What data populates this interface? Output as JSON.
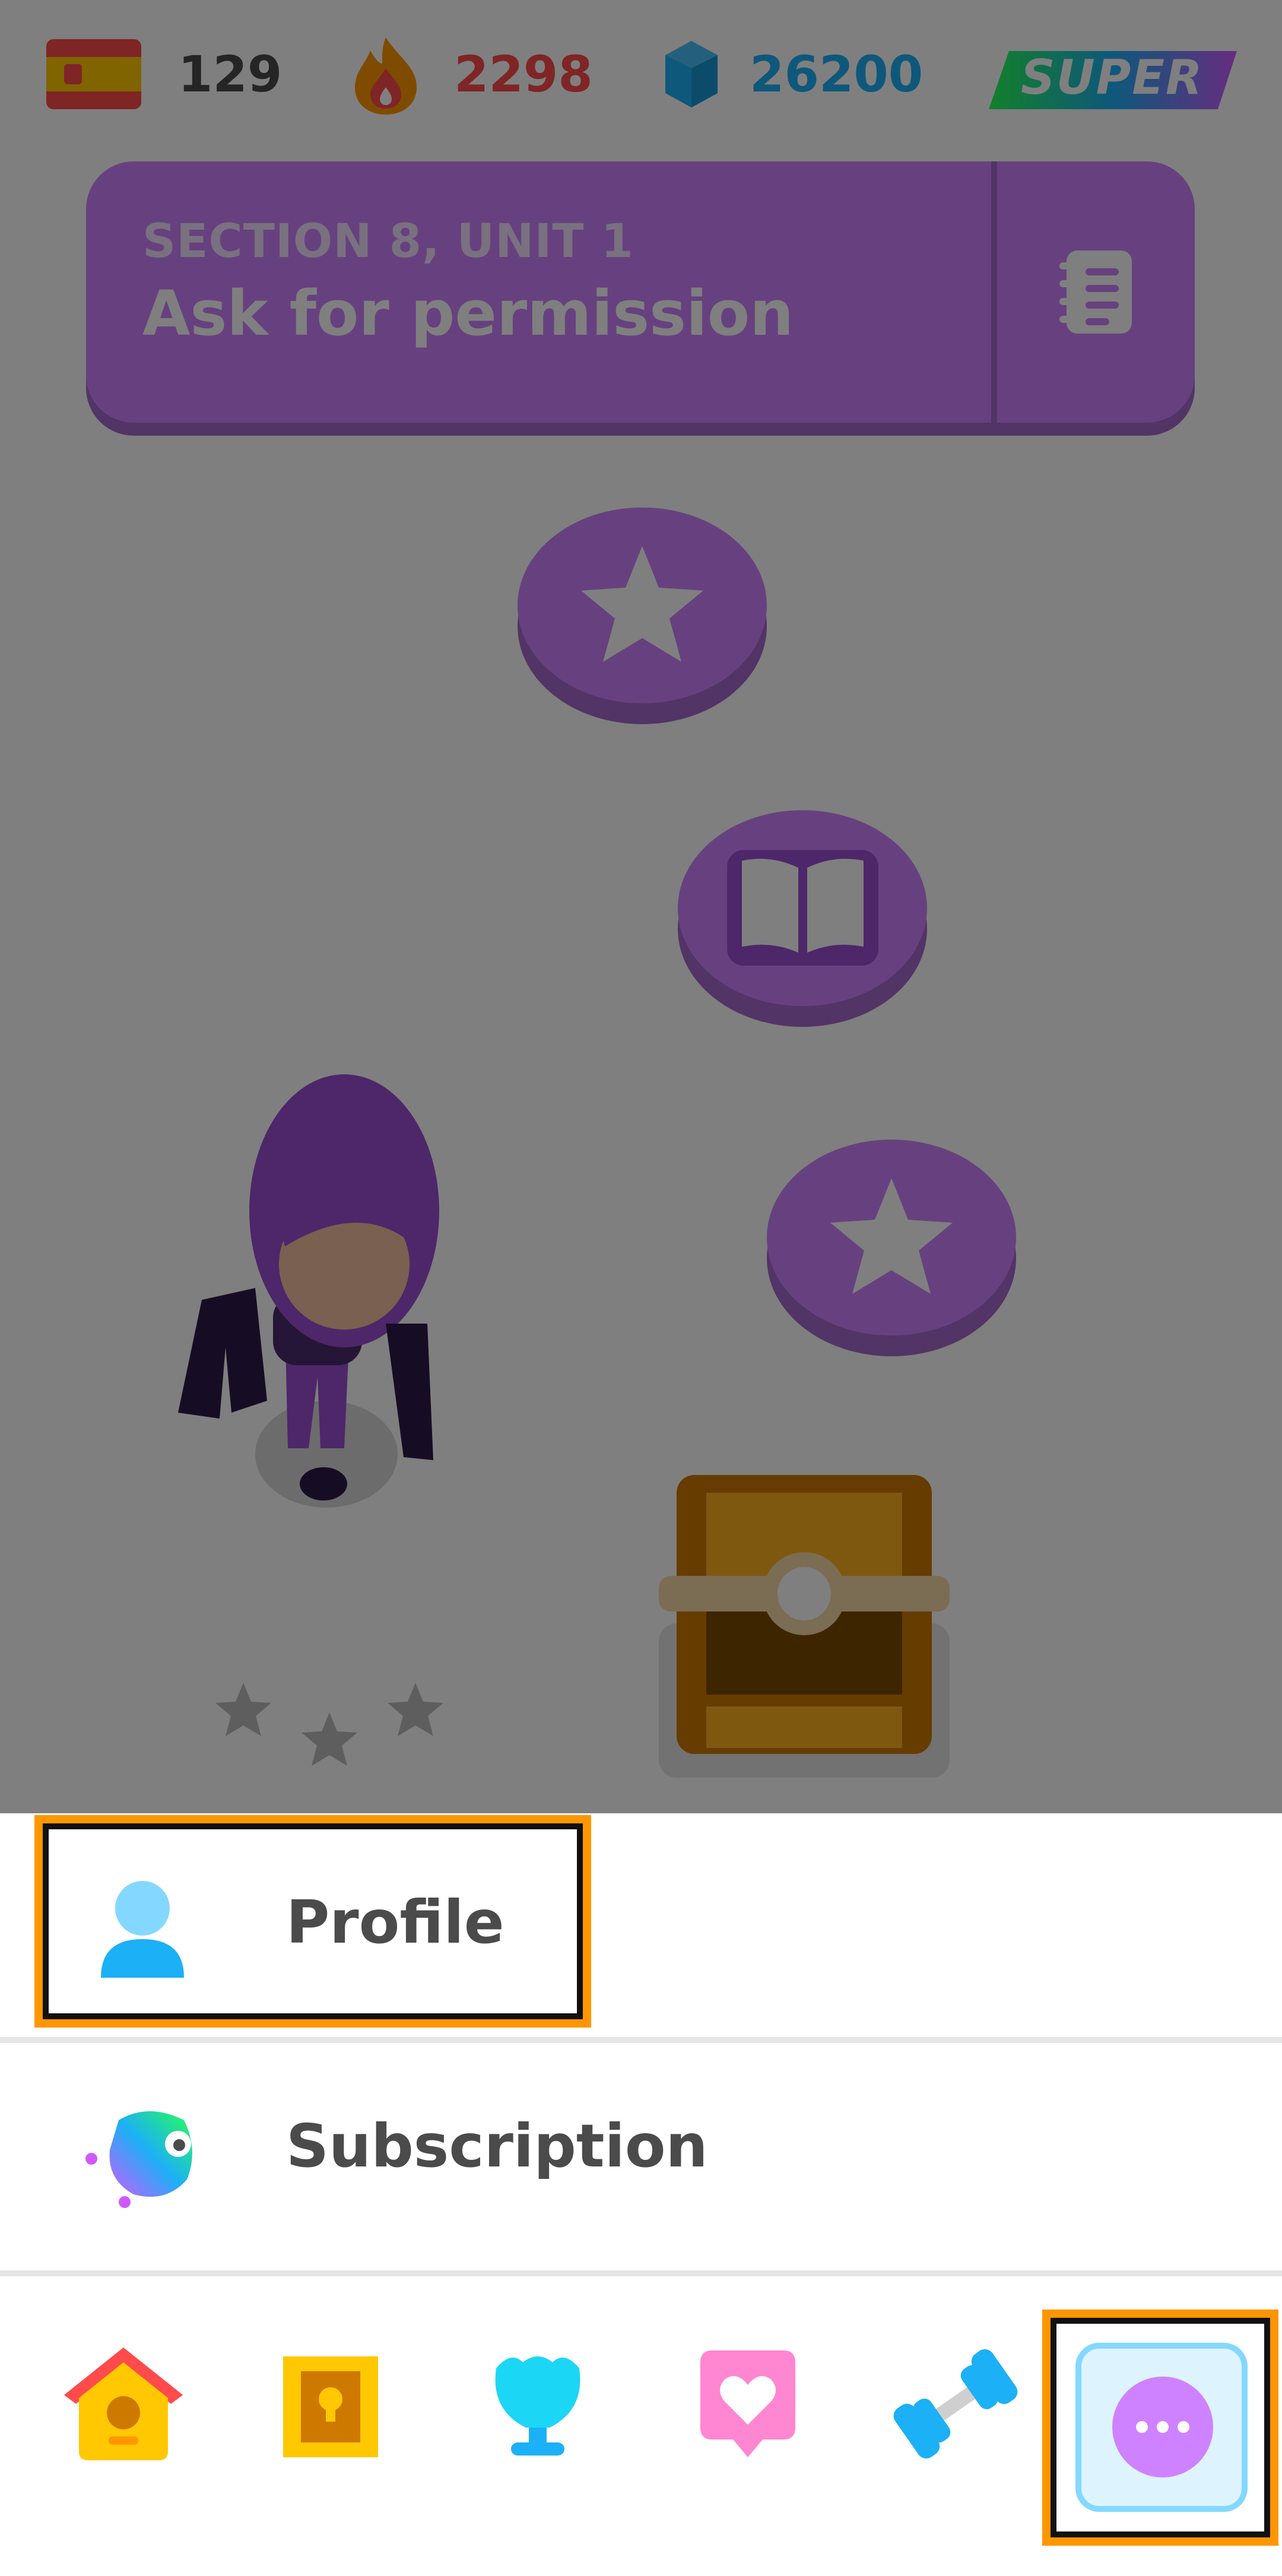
{
  "stats": {
    "language_flag": "spanish-flag-icon",
    "course_count": "129",
    "streak": "2298",
    "gems": "26200",
    "super_label": "SUPER"
  },
  "banner": {
    "section": "SECTION 8, UNIT 1",
    "title": "Ask for permission",
    "guide_icon": "guidebook-icon"
  },
  "path_nodes": [
    {
      "type": "star",
      "icon": "star-icon"
    },
    {
      "type": "story",
      "icon": "book-icon"
    },
    {
      "type": "star",
      "icon": "star-icon"
    },
    {
      "type": "chest",
      "icon": "treasure-chest-icon"
    }
  ],
  "menu": {
    "items": [
      {
        "label": "Profile",
        "icon": "profile-icon"
      },
      {
        "label": "Subscription",
        "icon": "subscription-icon"
      }
    ]
  },
  "tabs": [
    {
      "name": "home",
      "icon": "home-icon"
    },
    {
      "name": "quests",
      "icon": "chest-icon"
    },
    {
      "name": "leaderboard",
      "icon": "trophy-icon"
    },
    {
      "name": "friends",
      "icon": "heart-icon"
    },
    {
      "name": "practice",
      "icon": "dumbbell-icon"
    },
    {
      "name": "more",
      "icon": "more-icon"
    }
  ],
  "colors": {
    "accent_purple": "#ce82ff",
    "streak_red": "#ff4b4b",
    "gem_blue": "#1cb0f6",
    "highlight_orange": "#ff9600"
  }
}
